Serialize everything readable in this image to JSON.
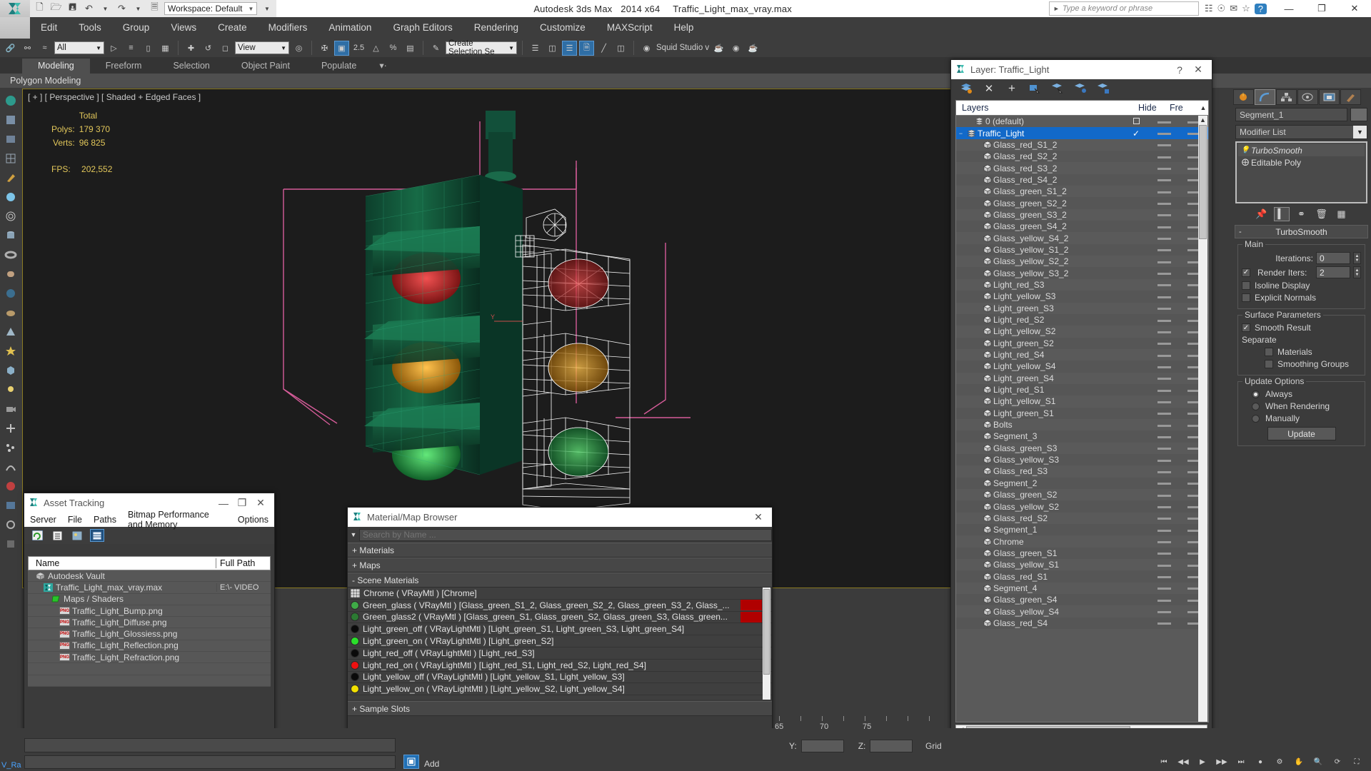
{
  "titlebar": {
    "workspace_label": "Workspace: Default",
    "app_title": "Autodesk 3ds Max",
    "app_version": "2014 x64",
    "file_name": "Traffic_Light_max_vray.max",
    "search_placeholder": "Type a keyword or phrase",
    "min_label": "—",
    "max_label": "❐",
    "close_label": "✕"
  },
  "menu": {
    "items": [
      "Edit",
      "Tools",
      "Group",
      "Views",
      "Create",
      "Modifiers",
      "Animation",
      "Graph Editors",
      "Rendering",
      "Customize",
      "MAXScript",
      "Help"
    ]
  },
  "maintoolbar": {
    "selection_filter": "All",
    "ref_coord_system": "View",
    "named_selection_set": "Create Selection Se",
    "workspace_plugin": "Squid Studio v"
  },
  "ribbon": {
    "tabs": [
      "Modeling",
      "Freeform",
      "Selection",
      "Object Paint",
      "Populate"
    ],
    "active_tab": "Modeling",
    "subtitle": "Polygon Modeling"
  },
  "viewport": {
    "label": "[ + ] [ Perspective ] [ Shaded + Edged Faces ]",
    "stats_header": "Total",
    "polys_label": "Polys:",
    "polys_value": "179 370",
    "verts_label": "Verts:",
    "verts_value": "96 825",
    "fps_label": "FPS:",
    "fps_value": "202,552"
  },
  "layer_dialog": {
    "title": "Layer: Traffic_Light",
    "help_label": "?",
    "close_label": "✕",
    "columns": [
      "Layers",
      "",
      "Hide",
      "Fre"
    ],
    "rows": [
      {
        "name": "0 (default)",
        "indent": 1,
        "type": "layer",
        "selected": false,
        "box": true
      },
      {
        "name": "Traffic_Light",
        "indent": 0,
        "type": "layer",
        "selected": true,
        "check": true,
        "expander": "−"
      },
      {
        "name": "Glass_red_S1_2",
        "indent": 2,
        "type": "object"
      },
      {
        "name": "Glass_red_S2_2",
        "indent": 2,
        "type": "object"
      },
      {
        "name": "Glass_red_S3_2",
        "indent": 2,
        "type": "object"
      },
      {
        "name": "Glass_red_S4_2",
        "indent": 2,
        "type": "object"
      },
      {
        "name": "Glass_green_S1_2",
        "indent": 2,
        "type": "object"
      },
      {
        "name": "Glass_green_S2_2",
        "indent": 2,
        "type": "object"
      },
      {
        "name": "Glass_green_S3_2",
        "indent": 2,
        "type": "object"
      },
      {
        "name": "Glass_green_S4_2",
        "indent": 2,
        "type": "object"
      },
      {
        "name": "Glass_yellow_S4_2",
        "indent": 2,
        "type": "object"
      },
      {
        "name": "Glass_yellow_S1_2",
        "indent": 2,
        "type": "object"
      },
      {
        "name": "Glass_yellow_S2_2",
        "indent": 2,
        "type": "object"
      },
      {
        "name": "Glass_yellow_S3_2",
        "indent": 2,
        "type": "object"
      },
      {
        "name": "Light_red_S3",
        "indent": 2,
        "type": "object"
      },
      {
        "name": "Light_yellow_S3",
        "indent": 2,
        "type": "object"
      },
      {
        "name": "Light_green_S3",
        "indent": 2,
        "type": "object"
      },
      {
        "name": "Light_red_S2",
        "indent": 2,
        "type": "object"
      },
      {
        "name": "Light_yellow_S2",
        "indent": 2,
        "type": "object"
      },
      {
        "name": "Light_green_S2",
        "indent": 2,
        "type": "object"
      },
      {
        "name": "Light_red_S4",
        "indent": 2,
        "type": "object"
      },
      {
        "name": "Light_yellow_S4",
        "indent": 2,
        "type": "object"
      },
      {
        "name": "Light_green_S4",
        "indent": 2,
        "type": "object"
      },
      {
        "name": "Light_red_S1",
        "indent": 2,
        "type": "object"
      },
      {
        "name": "Light_yellow_S1",
        "indent": 2,
        "type": "object"
      },
      {
        "name": "Light_green_S1",
        "indent": 2,
        "type": "object"
      },
      {
        "name": "Bolts",
        "indent": 2,
        "type": "object"
      },
      {
        "name": "Segment_3",
        "indent": 2,
        "type": "object"
      },
      {
        "name": "Glass_green_S3",
        "indent": 2,
        "type": "object"
      },
      {
        "name": "Glass_yellow_S3",
        "indent": 2,
        "type": "object"
      },
      {
        "name": "Glass_red_S3",
        "indent": 2,
        "type": "object"
      },
      {
        "name": "Segment_2",
        "indent": 2,
        "type": "object"
      },
      {
        "name": "Glass_green_S2",
        "indent": 2,
        "type": "object"
      },
      {
        "name": "Glass_yellow_S2",
        "indent": 2,
        "type": "object"
      },
      {
        "name": "Glass_red_S2",
        "indent": 2,
        "type": "object"
      },
      {
        "name": "Segment_1",
        "indent": 2,
        "type": "object"
      },
      {
        "name": "Chrome",
        "indent": 2,
        "type": "object"
      },
      {
        "name": "Glass_green_S1",
        "indent": 2,
        "type": "object"
      },
      {
        "name": "Glass_yellow_S1",
        "indent": 2,
        "type": "object"
      },
      {
        "name": "Glass_red_S1",
        "indent": 2,
        "type": "object"
      },
      {
        "name": "Segment_4",
        "indent": 2,
        "type": "object"
      },
      {
        "name": "Glass_green_S4",
        "indent": 2,
        "type": "object"
      },
      {
        "name": "Glass_yellow_S4",
        "indent": 2,
        "type": "object"
      },
      {
        "name": "Glass_red_S4",
        "indent": 2,
        "type": "object"
      }
    ]
  },
  "asset_tracking": {
    "title": "Asset Tracking",
    "min_label": "—",
    "max_label": "❐",
    "close_label": "✕",
    "menu": [
      "Server",
      "File",
      "Paths",
      "Bitmap Performance and Memory",
      "Options"
    ],
    "columns": [
      "Name",
      "Full Path"
    ],
    "rows": [
      {
        "name": "Autodesk Vault",
        "indent": 1,
        "icon": "vault-icon",
        "path": ""
      },
      {
        "name": "Traffic_Light_max_vray.max",
        "indent": 2,
        "icon": "max-file-icon",
        "path": "E:\\- VIDEO"
      },
      {
        "name": "Maps / Shaders",
        "indent": 3,
        "icon": "maps-icon",
        "path": ""
      },
      {
        "name": "Traffic_Light_Bump.png",
        "indent": 4,
        "icon": "png-icon",
        "path": ""
      },
      {
        "name": "Traffic_Light_Diffuse.png",
        "indent": 4,
        "icon": "png-icon",
        "path": ""
      },
      {
        "name": "Traffic_Light_Glossiess.png",
        "indent": 4,
        "icon": "png-icon",
        "path": ""
      },
      {
        "name": "Traffic_Light_Reflection.png",
        "indent": 4,
        "icon": "png-icon",
        "path": ""
      },
      {
        "name": "Traffic_Light_Refraction.png",
        "indent": 4,
        "icon": "png-icon",
        "path": ""
      }
    ]
  },
  "material_browser": {
    "title": "Material/Map Browser",
    "close_label": "✕",
    "search_placeholder": "Search by Name ...",
    "groups": [
      {
        "label": "+ Materials",
        "expanded": false
      },
      {
        "label": "+ Maps",
        "expanded": false
      },
      {
        "label": "- Scene Materials",
        "expanded": true
      }
    ],
    "footer_group": "+ Sample Slots",
    "materials": [
      {
        "label": "Chrome  ( VRayMtl )  [Chrome]",
        "swatch": "checker",
        "color": "#cccccc",
        "flag": false
      },
      {
        "label": "Green_glass ( VRayMtl ) [Glass_green_S1_2, Glass_green_S2_2, Glass_green_S3_2, Glass_...",
        "swatch": "round",
        "color": "#3faa47",
        "flag": true
      },
      {
        "label": "Green_glass2 ( VRayMtl ) [Glass_green_S1, Glass_green_S2, Glass_green_S3, Glass_green...",
        "swatch": "round",
        "color": "#2c7a33",
        "flag": true
      },
      {
        "label": "Light_green_off  ( VRayLightMtl )  [Light_green_S1, Light_green_S3, Light_green_S4]",
        "swatch": "round",
        "color": "#0a0a0a",
        "flag": false
      },
      {
        "label": "Light_green_on  ( VRayLightMtl )  [Light_green_S2]",
        "swatch": "round",
        "color": "#2bdf2b",
        "flag": false
      },
      {
        "label": "Light_red_off  ( VRayLightMtl )  [Light_red_S3]",
        "swatch": "round",
        "color": "#0a0a0a",
        "flag": false
      },
      {
        "label": "Light_red_on  ( VRayLightMtl )  [Light_red_S1, Light_red_S2, Light_red_S4]",
        "swatch": "round",
        "color": "#ee1111",
        "flag": false
      },
      {
        "label": "Light_yellow_off  ( VRayLightMtl )  [Light_yellow_S1, Light_yellow_S3]",
        "swatch": "round",
        "color": "#0a0a0a",
        "flag": false
      },
      {
        "label": "Light_yellow_on  ( VRayLightMtl )  [Light_yellow_S2, Light_yellow_S4]",
        "swatch": "round",
        "color": "#f2e000",
        "flag": false
      }
    ]
  },
  "command_panel": {
    "object_name": "Segment_1",
    "modifier_list_label": "Modifier List",
    "stack": [
      {
        "label": "TurboSmooth",
        "active": true
      },
      {
        "label": "Editable Poly",
        "active": false
      }
    ],
    "rollup_title": "TurboSmooth",
    "rollup_minus": "-",
    "main_group": "Main",
    "iterations_label": "Iterations:",
    "iterations_value": "0",
    "render_iters_label": "Render Iters:",
    "render_iters_value": "2",
    "render_iters_checked": true,
    "isoline_label": "Isoline Display",
    "explicit_normals_label": "Explicit Normals",
    "surface_group": "Surface Parameters",
    "smooth_result_label": "Smooth Result",
    "smooth_result_checked": true,
    "separate_label": "Separate",
    "materials_label": "Materials",
    "smoothing_groups_label": "Smoothing Groups",
    "update_group": "Update Options",
    "update_options": [
      "Always",
      "When Rendering",
      "Manually"
    ],
    "update_selected": "Always",
    "update_button": "Update"
  },
  "statusbar": {
    "y_label": "Y:",
    "z_label": "Z:",
    "grid_label": "Grid",
    "add_time_tag": "Add",
    "vray_tag": "V_Ra",
    "ruler_ticks": [
      "65",
      "70",
      "75"
    ]
  },
  "colors": {
    "accent_blue": "#1269c9",
    "viewport_border": "#8b7b22",
    "stats_yellow": "#e2c75a",
    "panel_bg": "#3b3b3b",
    "dialog_title_bg": "#ffffff"
  }
}
